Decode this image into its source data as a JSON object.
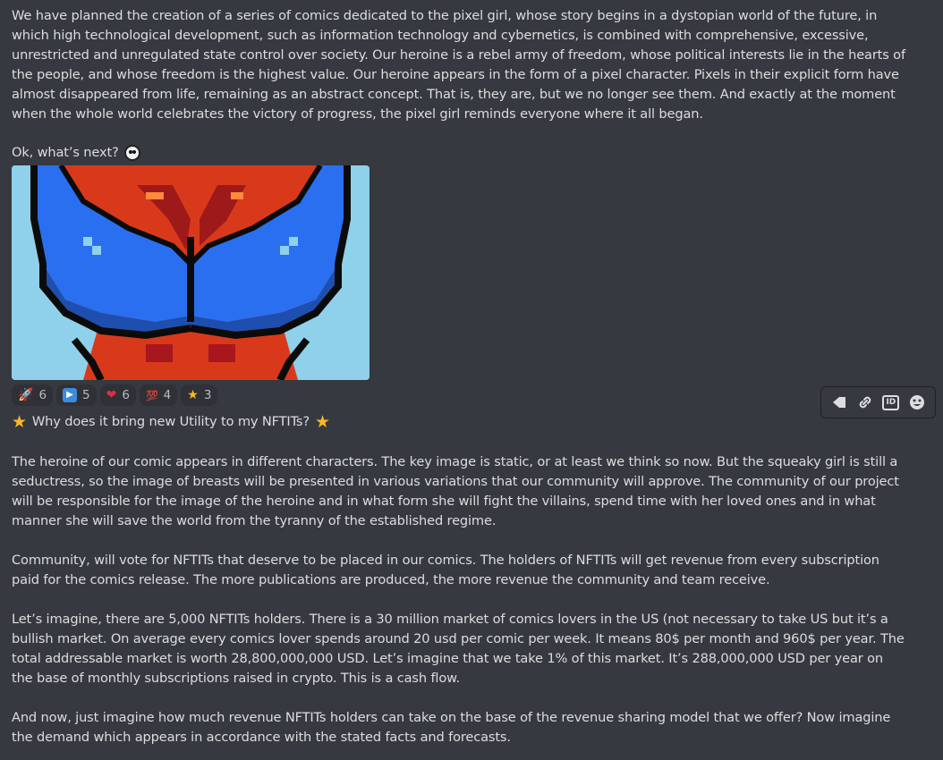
{
  "message": {
    "intro": "We have planned the creation of a series of comics dedicated to the pixel girl, whose story begins in a dystopian world of the future, in which high technological development, such as information technology and cybernetics, is combined with comprehensive, excessive, unrestricted and unregulated state control over society. Our heroine is a rebel army of freedom, whose political interests lie in the hearts of the people, and whose freedom is the highest value. Our heroine appears in the form of a pixel character. Pixels in their explicit form have almost disappeared from life, remaining as an abstract concept. That is, they are, but we no longer see them. And exactly at the moment when the whole world celebrates the victory of progress, the pixel girl reminds everyone where it all began.",
    "ok_line": "Ok, what’s next?",
    "heading": "Why does it bring new Utility to my NFTITs?",
    "para2": "The heroine of our comic appears in different characters. The key image is static, or at least we think so now. But the squeaky girl is still a seductress, so the image of breasts will be presented in various variations that our community will approve. The community of our project will be responsible for the image of the heroine and in what form she will fight the villains, spend time with her loved ones and in what manner she will save the world from the tyranny of the established regime.",
    "para3": "Community, will vote for NFTITs that deserve to be placed in our comics. The holders of NFTITs will get revenue from every subscription paid for the comics release. The more publications are produced, the more revenue the community and team receive.",
    "para4": "Let’s imagine, there are 5,000 NFTITs holders. There is a 30 million market of comics lovers in the US (not necessary to take US but it’s a bullish market. On average every comics lover spends around 20 usd per comic per week. It means 80$ per month and 960$ per year. The total addressable market is worth 28,800,000,000 USD. Let’s imagine that we take 1% of this market. It’s 288,000,000 USD per year on the base of monthly subscriptions raised in crypto. This is a cash flow.",
    "para5": "And now, just imagine how much revenue NFTITs holders can take on the base of the revenue sharing model that we offer? Now imagine the demand which appears in accordance with the stated facts and forecasts."
  },
  "reactions": [
    {
      "icon": "rocket-icon",
      "glyph": "🚀",
      "count": "6"
    },
    {
      "icon": "play-button-icon",
      "glyph": "▶",
      "count": "5"
    },
    {
      "icon": "heart-icon",
      "glyph": "❤",
      "count": "6"
    },
    {
      "icon": "hundred-points-icon",
      "glyph": "💯",
      "count": "4"
    },
    {
      "icon": "star-icon",
      "glyph": "★",
      "count": "3"
    }
  ],
  "toolbar": [
    {
      "icon": "add-reaction-icon"
    },
    {
      "icon": "link-icon"
    },
    {
      "icon": "copy-id-icon",
      "label": "ID"
    },
    {
      "icon": "emoji-icon"
    }
  ],
  "colors": {
    "background": "#36393f",
    "text": "#dcddde",
    "reaction_bg": "#2f3136",
    "image_bg": "#8fd1ea",
    "image_red": "#d9391b",
    "image_blue": "#2a6ff0",
    "image_dark": "#0b0b0b"
  }
}
